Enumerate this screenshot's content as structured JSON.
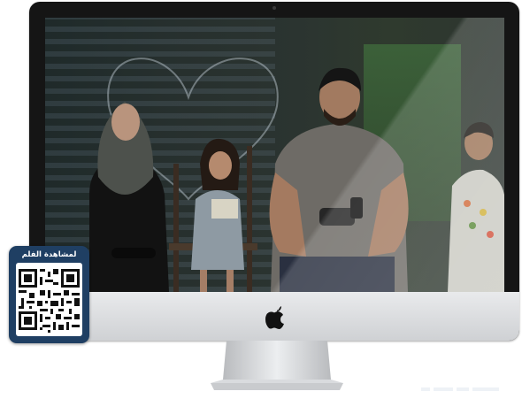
{
  "qr_card": {
    "label": "لمشاهدة الفلم",
    "icon": "qr-code-icon"
  },
  "monitor": {
    "brand_icon": "apple-logo-icon"
  },
  "colors": {
    "qr_card_bg": "#1f3f63",
    "bezel": "#151515",
    "chin": "#e2e3e5"
  }
}
